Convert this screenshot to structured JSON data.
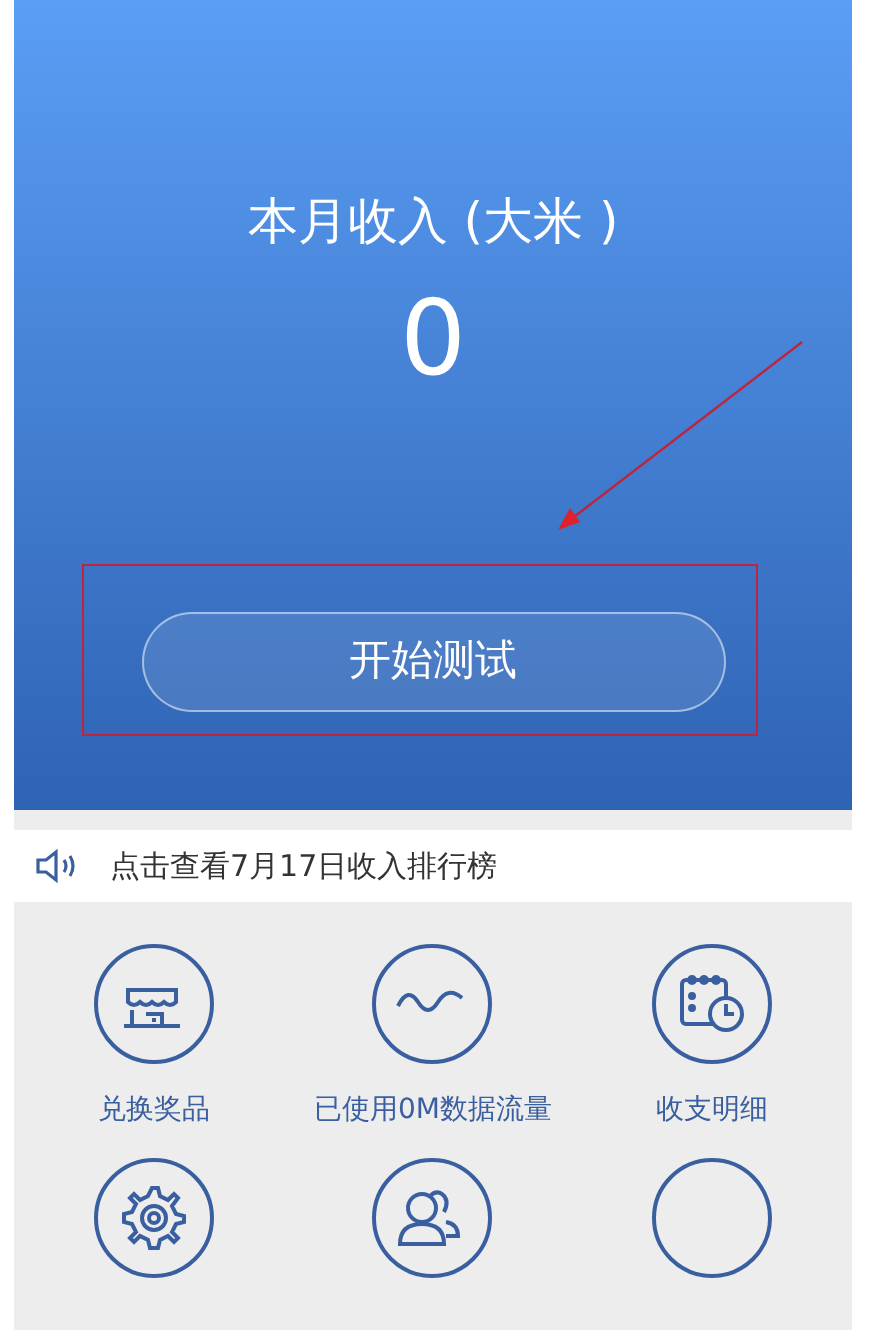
{
  "header": {
    "title": "本月收入 (大米 )",
    "amount": "0",
    "button": "开始测试"
  },
  "notice": {
    "text": "点击查看7月17日收入排行榜"
  },
  "grid": [
    {
      "kind": "store",
      "label": "兑换奖品"
    },
    {
      "kind": "wave",
      "label": "已使用0M数据流量"
    },
    {
      "kind": "calendar",
      "label": "收支明细"
    },
    {
      "kind": "gear"
    },
    {
      "kind": "people"
    },
    {
      "kind": "other"
    }
  ]
}
